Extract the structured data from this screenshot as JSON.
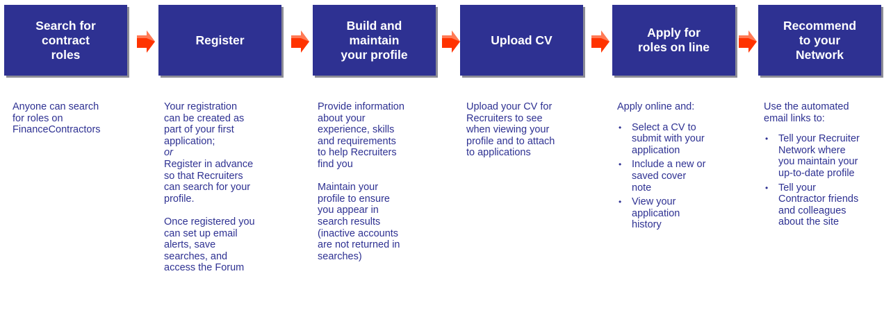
{
  "steps": [
    {
      "title": "Search for\ncontract\nroles",
      "paragraphs": [
        {
          "text": "Anyone can search\nfor roles on\nFinanceContractors"
        }
      ]
    },
    {
      "title": "Register",
      "paragraphs": [
        {
          "text": "Your registration\ncan be created as\npart of your first\napplication;"
        },
        {
          "text": "or"
        },
        {
          "text": "Register in advance\nso that Recruiters\ncan search for your\nprofile."
        },
        {
          "text": "Once registered you\ncan set up email\nalerts, save\nsearches, and\naccess the Forum"
        }
      ]
    },
    {
      "title": "Build and\nmaintain\nyour profile",
      "paragraphs": [
        {
          "text": "Provide information\nabout your\nexperience, skills\nand requirements\nto help Recruiters\nfind you"
        },
        {
          "text": "Maintain your\nprofile to ensure\nyou appear in\nsearch results\n(inactive accounts\nare not returned in\nsearches)"
        }
      ]
    },
    {
      "title": "Upload CV",
      "paragraphs": [
        {
          "text": "Upload your CV  for\nRecruiters to see\nwhen viewing your\nprofile and to attach\nto applications"
        }
      ]
    },
    {
      "title": "Apply for\nroles on line",
      "paragraphs": [
        {
          "text": "Apply online and:"
        }
      ],
      "bullets": [
        "Select a CV  to\nsubmit with your\napplication",
        "Include a new or\nsaved cover\nnote",
        "View your\napplication\nhistory"
      ]
    },
    {
      "title": "Recommend\nto your\nNetwork",
      "paragraphs": [
        {
          "text": "Use the automated\nemail links to:"
        }
      ],
      "bullets": [
        "Tell your Recruiter\nNetwork where\nyou maintain your\nup-to-date profile",
        "Tell your\nContractor friends\nand colleagues\nabout the site"
      ]
    }
  ],
  "bullet_glyph": "•",
  "colors": {
    "box": "#2e3192",
    "box_shadow": "#8c8c96",
    "text": "#2e3192",
    "arrow": "#ff3300"
  }
}
